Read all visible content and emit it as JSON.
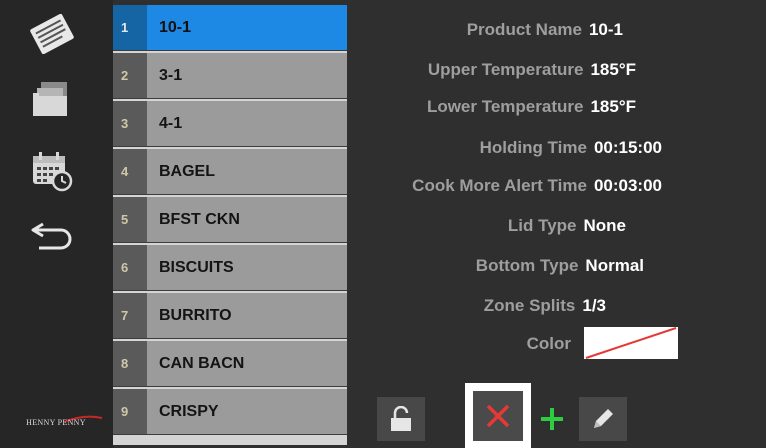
{
  "brand": {
    "text": "HENNY PENNY"
  },
  "sidebar": {
    "icons": [
      "recipes-icon",
      "files-icon",
      "calendar-clock-icon",
      "back-arrow-icon"
    ]
  },
  "products": [
    {
      "num": "1",
      "name": "10-1"
    },
    {
      "num": "2",
      "name": "3-1"
    },
    {
      "num": "3",
      "name": "4-1"
    },
    {
      "num": "4",
      "name": "BAGEL"
    },
    {
      "num": "5",
      "name": "BFST CKN"
    },
    {
      "num": "6",
      "name": "BISCUITS"
    },
    {
      "num": "7",
      "name": "BURRITO"
    },
    {
      "num": "8",
      "name": "CAN BACN"
    },
    {
      "num": "9",
      "name": "CRISPY"
    }
  ],
  "selected_index": 0,
  "details": {
    "product_name": {
      "label": "Product Name",
      "value": "10-1"
    },
    "upper_temp": {
      "label": "Upper Temperature",
      "value": "185°F"
    },
    "lower_temp": {
      "label": "Lower Temperature",
      "value": "185°F"
    },
    "holding_time": {
      "label": "Holding Time",
      "value": "00:15:00"
    },
    "cook_more": {
      "label": "Cook More Alert Time",
      "value": "00:03:00"
    },
    "lid_type": {
      "label": "Lid Type",
      "value": "None"
    },
    "bottom_type": {
      "label": "Bottom Type",
      "value": "Normal"
    },
    "zone_splits": {
      "label": "Zone Splits",
      "value": "1/3"
    },
    "color": {
      "label": "Color",
      "value": "none"
    }
  },
  "colors": {
    "selected_row": "#1e88e5",
    "delete": "#e53935",
    "add": "#2ecc40",
    "swatch_slash": "#e53935"
  },
  "buttons": {
    "lock": "unlock-icon",
    "delete": "close-icon",
    "add": "plus-icon",
    "edit": "pencil-icon"
  }
}
